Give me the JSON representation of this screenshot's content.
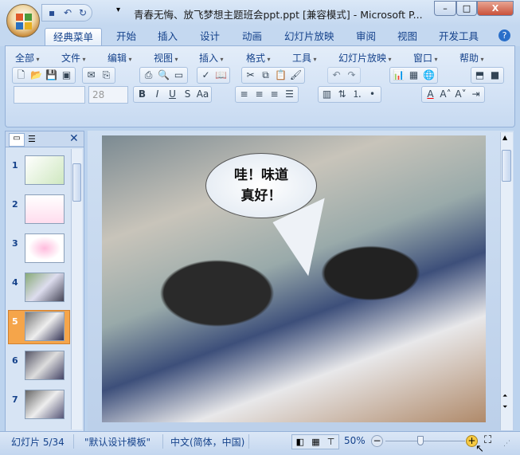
{
  "window": {
    "title": "青春无悔、放飞梦想主题班会ppt.ppt [兼容模式] - Microsoft P...",
    "minimize": "–",
    "maximize": "□",
    "close": "X"
  },
  "tabs": [
    "经典菜单",
    "开始",
    "插入",
    "设计",
    "动画",
    "幻灯片放映",
    "审阅",
    "视图",
    "开发工具"
  ],
  "menus": [
    "全部",
    "文件",
    "编辑",
    "视图",
    "插入",
    "格式",
    "工具",
    "幻灯片放映",
    "窗口",
    "帮助"
  ],
  "font_size": "28",
  "slides": [
    "1",
    "2",
    "3",
    "4",
    "5",
    "6",
    "7"
  ],
  "selected_slide": "5",
  "slide": {
    "bubble_line1": "哇！味道",
    "bubble_line2": "真好！"
  },
  "status": {
    "slide": "幻灯片 5/34",
    "theme": "\"默认设计模板\"",
    "language": "中文(简体，中国)",
    "zoom": "50%"
  },
  "zoom_fraction": 0.5
}
